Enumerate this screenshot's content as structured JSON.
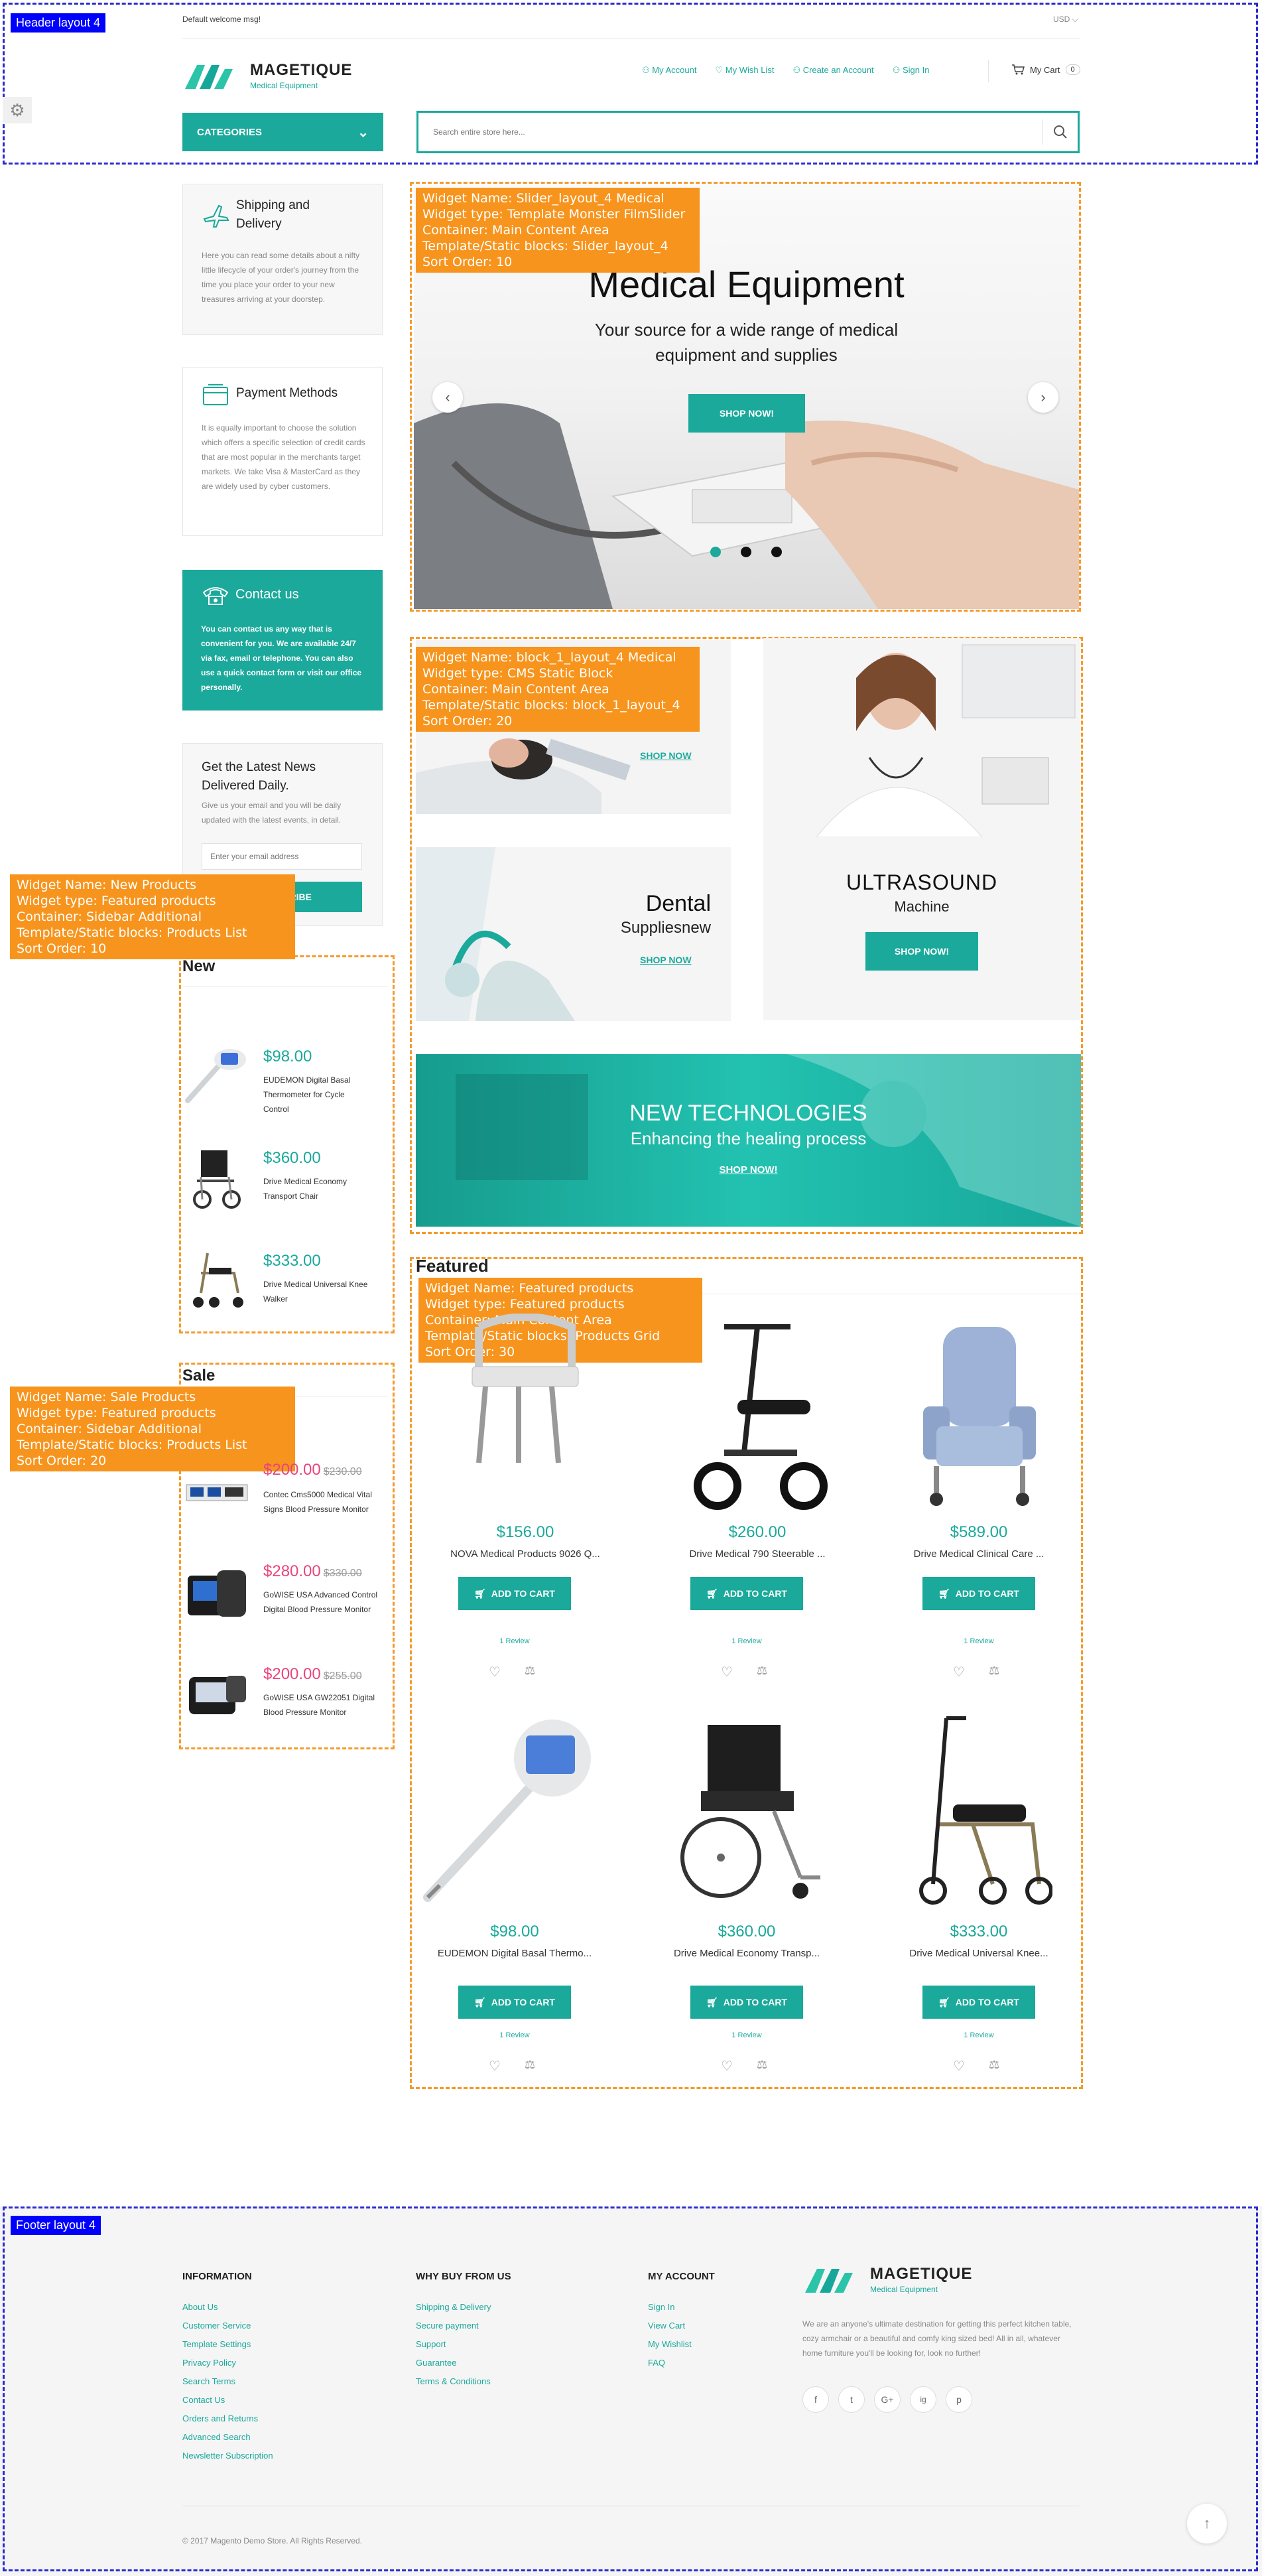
{
  "header": {
    "welcome": "Default welcome msg!",
    "currency": "USD",
    "logo_name": "MAGETIQUE",
    "logo_tag": "Medical Equipment",
    "links": [
      "My Account",
      "My Wish List",
      "Create an Account",
      "Sign In"
    ],
    "cart_label": "My Cart",
    "cart_count": "0",
    "categories": "CATEGORIES",
    "search_placeholder": "Search entire store here...",
    "layout_tag": "Header layout 4"
  },
  "sidebar": {
    "shipping_title": "Shipping and Delivery",
    "shipping_text": "Here you can read some details about a nifty little lifecycle of your order's journey from the time you place your order to your new treasures arriving at your doorstep.",
    "payment_title": "Payment Methods",
    "payment_text": "It is equally important to choose the solution which offers a specific selection of credit cards that are most popular in the merchants target markets. We take Visa & MasterCard as they are widely used by cyber customers.",
    "contact_title": "Contact us",
    "contact_text": "You can contact us any way that is convenient for you. We are available 24/7 via fax, email or telephone. You can also use a quick contact form or visit our office personally.",
    "news_title": "Get the Latest News Delivered Daily.",
    "news_text": "Give us your email and you will be daily updated with the latest events, in detail.",
    "news_placeholder": "Enter your email address",
    "news_button": "SUBSCRIBE",
    "new_title": "New",
    "new_tag": "Widget Name:   New Products\nWidget type: Featured products\nContainer: Sidebar Additional\nTemplate/Static blocks: Products List\nSort Order: 10",
    "new_items": [
      {
        "price": "$98.00",
        "name": "EUDEMON Digital Basal Thermometer for Cycle Control"
      },
      {
        "price": "$360.00",
        "name": "Drive Medical Economy Transport Chair"
      },
      {
        "price": "$333.00",
        "name": "Drive Medical Universal Knee Walker"
      }
    ],
    "sale_title": "Sale",
    "sale_tag": "Widget Name:   Sale Products\nWidget type: Featured products\nContainer: Sidebar Additional\nTemplate/Static blocks: Products List\nSort Order: 20",
    "sale_items": [
      {
        "price": "$200.00",
        "old": "$230.00",
        "name": "Contec Cms5000 Medical Vital Signs Blood Pressure Monitor"
      },
      {
        "price": "$280.00",
        "old": "$330.00",
        "name": "GoWISE USA Advanced Control Digital Blood Pressure Monitor"
      },
      {
        "price": "$200.00",
        "old": "$255.00",
        "name": "GoWISE USA GW22051 Digital Blood Pressure Monitor"
      }
    ]
  },
  "slider": {
    "tag": "Widget Name: Slider_layout_4 Medical\nWidget type: Template Monster FilmSlider\nContainer: Main Content Area\nTemplate/Static blocks: Slider_layout_4\nSort Order: 10",
    "title": "Medical Equipment",
    "subtitle": "Your source for a wide range of medical equipment and supplies",
    "button": "SHOP NOW!"
  },
  "blocks": {
    "tag": "Widget Name: block_1_layout_4 Medical\nWidget type: CMS Static Block\nContainer: Main Content Area\nTemplate/Static blocks: block_1_layout_4\nSort Order: 20",
    "shop_now": "SHOP NOW",
    "dental_title": "Dental",
    "dental_sub": "Suppliesnew",
    "ultra_title": "ULTRASOUND",
    "ultra_sub": "Machine",
    "ultra_button": "SHOP NOW!",
    "tech_title": "NEW TECHNOLOGIES",
    "tech_sub": "Enhancing the healing process",
    "tech_link": "SHOP NOW!"
  },
  "featured": {
    "title": "Featured",
    "tag": "Widget Name: Featured products\nWidget type: Featured products\nContainer: Main Content Area\nTemplate/Static blocks: Products Grid\nSort Order: 30",
    "add_label": "ADD TO CART",
    "review": "1 Review",
    "products": [
      {
        "price": "$156.00",
        "name": "NOVA Medical Products 9026 Q..."
      },
      {
        "price": "$260.00",
        "name": "Drive Medical 790 Steerable ..."
      },
      {
        "price": "$589.00",
        "name": "Drive Medical Clinical Care ..."
      },
      {
        "price": "$98.00",
        "name": "EUDEMON Digital Basal Thermo..."
      },
      {
        "price": "$360.00",
        "name": "Drive Medical Economy Transp..."
      },
      {
        "price": "$333.00",
        "name": "Drive Medical Universal Knee..."
      }
    ]
  },
  "footer": {
    "tag": "Footer layout 4",
    "info_title": "INFORMATION",
    "info_links": [
      "About Us",
      "Customer Service",
      "Template Settings",
      "Privacy Policy",
      "Search Terms",
      "Contact Us",
      "Orders and Returns",
      "Advanced Search",
      "Newsletter Subscription"
    ],
    "why_title": "WHY BUY FROM US",
    "why_links": [
      "Shipping & Delivery",
      "Secure payment",
      "Support",
      "Guarantee",
      "Terms & Conditions"
    ],
    "acc_title": "MY ACCOUNT",
    "acc_links": [
      "Sign In",
      "View Cart",
      "My Wishlist",
      "FAQ"
    ],
    "logo_name": "MAGETIQUE",
    "logo_tag": "Medical Equipment",
    "about": "We are an anyone's ultimate destination for getting this perfect kitchen table, cozy armchair or a beautiful and comfy king sized bed! All in all, whatever home furniture you'll be looking for, look no further!",
    "social": [
      "f",
      "t",
      "G+",
      "ig",
      "p"
    ],
    "copyright": "© 2017 Magento Demo Store. All Rights Reserved."
  }
}
